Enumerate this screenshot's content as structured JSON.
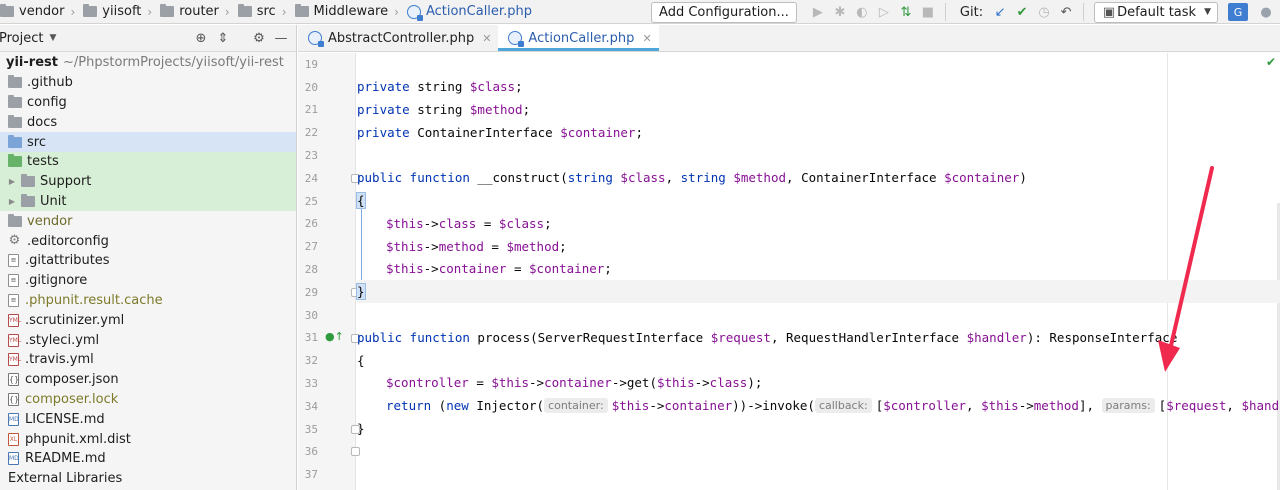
{
  "navbar": {
    "breadcrumbs": [
      "vendor",
      "yiisoft",
      "router",
      "src",
      "Middleware",
      "ActionCaller.php"
    ],
    "add_configuration": "Add Configuration...",
    "git_label": "Git:",
    "task_label": "Default task"
  },
  "project_panel": {
    "title": "Project",
    "tree": [
      {
        "label": "yii-rest",
        "extra": "~/PhpstormProjects/yiisoft/yii-rest",
        "kind": "root"
      },
      {
        "label": ".github",
        "kind": "folder"
      },
      {
        "label": "config",
        "kind": "folder"
      },
      {
        "label": "docs",
        "kind": "folder"
      },
      {
        "label": "src",
        "kind": "folder-blue",
        "selected": true
      },
      {
        "label": "tests",
        "kind": "folder-green"
      },
      {
        "label": "Support",
        "kind": "folder-collapsed"
      },
      {
        "label": "Unit",
        "kind": "folder-collapsed"
      },
      {
        "label": "vendor",
        "kind": "folder-muted"
      },
      {
        "label": ".editorconfig",
        "kind": "file-gear"
      },
      {
        "label": ".gitattributes",
        "kind": "file"
      },
      {
        "label": ".gitignore",
        "kind": "file"
      },
      {
        "label": ".phpunit.result.cache",
        "kind": "file-olive"
      },
      {
        "label": ".scrutinizer.yml",
        "kind": "file-yml"
      },
      {
        "label": ".styleci.yml",
        "kind": "file-yml"
      },
      {
        "label": ".travis.yml",
        "kind": "file-yml"
      },
      {
        "label": "composer.json",
        "kind": "file-json"
      },
      {
        "label": "composer.lock",
        "kind": "file-json-olive"
      },
      {
        "label": "LICENSE.md",
        "kind": "file-md"
      },
      {
        "label": "phpunit.xml.dist",
        "kind": "file-xml"
      },
      {
        "label": "README.md",
        "kind": "file-md"
      },
      {
        "label": "External Libraries",
        "kind": "libs"
      }
    ]
  },
  "tabs": [
    {
      "label": "AbstractController.php",
      "active": false
    },
    {
      "label": "ActionCaller.php",
      "active": true
    }
  ],
  "editor": {
    "line_numbers": [
      "19",
      "20",
      "21",
      "22",
      "23",
      "24",
      "25",
      "26",
      "27",
      "28",
      "29",
      "30",
      "31",
      "32",
      "33",
      "34",
      "35",
      "36",
      "37"
    ],
    "code": {
      "l20_kw": "private",
      "l20_type": " string ",
      "l20_var": "$class",
      "l20_end": ";",
      "l21_kw": "private",
      "l21_type": " string ",
      "l21_var": "$method",
      "l21_end": ";",
      "l22_kw": "private",
      "l22_type": " ContainerInterface ",
      "l22_var": "$container",
      "l22_end": ";",
      "l24_kw1": "public",
      "l24_kw2": " function ",
      "l24_name": "__construct(",
      "l24_t1": "string ",
      "l24_v1": "$class",
      "l24_c1": ", ",
      "l24_t2": "string ",
      "l24_v2": "$method",
      "l24_c2": ", ContainerInterface ",
      "l24_v3": "$container",
      "l24_end": ")",
      "l25": "{",
      "l26_v": "$this",
      "l26_p": "->",
      "l26_f": "class",
      "l26_eq": " = ",
      "l26_v2": "$class",
      "l26_end": ";",
      "l27_v": "$this",
      "l27_p": "->",
      "l27_f": "method",
      "l27_eq": " = ",
      "l27_v2": "$method",
      "l27_end": ";",
      "l28_v": "$this",
      "l28_p": "->",
      "l28_f": "container",
      "l28_eq": " = ",
      "l28_v2": "$container",
      "l28_end": ";",
      "l29": "}",
      "l31_kw1": "public",
      "l31_kw2": " function ",
      "l31_name": "process(ServerRequestInterface ",
      "l31_v1": "$request",
      "l31_c1": ", RequestHandlerInterface ",
      "l31_v2": "$handler",
      "l31_end": "): ResponseInterface",
      "l32": "{",
      "l33_v": "$controller",
      "l33_eq": " = ",
      "l33_v2": "$this",
      "l33_p": "->",
      "l33_f": "container",
      "l33_rest": "->get(",
      "l33_v3": "$this",
      "l33_p2": "->",
      "l33_f2": "class",
      "l33_end": ");",
      "l34_kw": "return",
      "l34_a": " (",
      "l34_kw2": "new",
      "l34_b": " Injector(",
      "l34_hint1": "container:",
      "l34_v1": "$this",
      "l34_p1": "->",
      "l34_f1": "container",
      "l34_c": "))->invoke(",
      "l34_hint2": "callback:",
      "l34_d": "[",
      "l34_v2": "$controller",
      "l34_e": ", ",
      "l34_v3": "$this",
      "l34_p3": "->",
      "l34_f3": "method",
      "l34_g": "], ",
      "l34_hint3": "params:",
      "l34_h": "[",
      "l34_v4": "$request",
      "l34_i": ", ",
      "l34_v5": "$handler",
      "l34_end": "]);",
      "l35": "}"
    }
  },
  "colors": {
    "accent": "#4fa6d8",
    "keyword": "#0033b3",
    "variable": "#871094",
    "annotation_arrow": "#f02a4f"
  }
}
